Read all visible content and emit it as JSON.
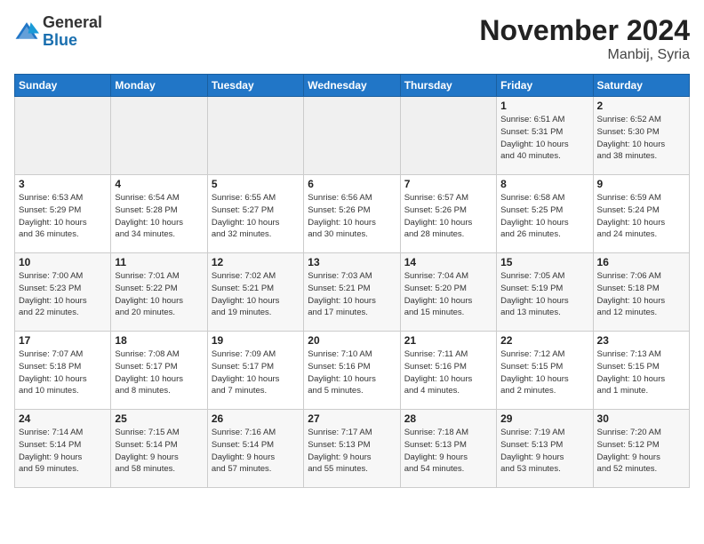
{
  "logo": {
    "line1": "General",
    "line2": "Blue"
  },
  "header": {
    "month": "November 2024",
    "location": "Manbij, Syria"
  },
  "weekdays": [
    "Sunday",
    "Monday",
    "Tuesday",
    "Wednesday",
    "Thursday",
    "Friday",
    "Saturday"
  ],
  "weeks": [
    [
      {
        "day": "",
        "info": ""
      },
      {
        "day": "",
        "info": ""
      },
      {
        "day": "",
        "info": ""
      },
      {
        "day": "",
        "info": ""
      },
      {
        "day": "",
        "info": ""
      },
      {
        "day": "1",
        "info": "Sunrise: 6:51 AM\nSunset: 5:31 PM\nDaylight: 10 hours\nand 40 minutes."
      },
      {
        "day": "2",
        "info": "Sunrise: 6:52 AM\nSunset: 5:30 PM\nDaylight: 10 hours\nand 38 minutes."
      }
    ],
    [
      {
        "day": "3",
        "info": "Sunrise: 6:53 AM\nSunset: 5:29 PM\nDaylight: 10 hours\nand 36 minutes."
      },
      {
        "day": "4",
        "info": "Sunrise: 6:54 AM\nSunset: 5:28 PM\nDaylight: 10 hours\nand 34 minutes."
      },
      {
        "day": "5",
        "info": "Sunrise: 6:55 AM\nSunset: 5:27 PM\nDaylight: 10 hours\nand 32 minutes."
      },
      {
        "day": "6",
        "info": "Sunrise: 6:56 AM\nSunset: 5:26 PM\nDaylight: 10 hours\nand 30 minutes."
      },
      {
        "day": "7",
        "info": "Sunrise: 6:57 AM\nSunset: 5:26 PM\nDaylight: 10 hours\nand 28 minutes."
      },
      {
        "day": "8",
        "info": "Sunrise: 6:58 AM\nSunset: 5:25 PM\nDaylight: 10 hours\nand 26 minutes."
      },
      {
        "day": "9",
        "info": "Sunrise: 6:59 AM\nSunset: 5:24 PM\nDaylight: 10 hours\nand 24 minutes."
      }
    ],
    [
      {
        "day": "10",
        "info": "Sunrise: 7:00 AM\nSunset: 5:23 PM\nDaylight: 10 hours\nand 22 minutes."
      },
      {
        "day": "11",
        "info": "Sunrise: 7:01 AM\nSunset: 5:22 PM\nDaylight: 10 hours\nand 20 minutes."
      },
      {
        "day": "12",
        "info": "Sunrise: 7:02 AM\nSunset: 5:21 PM\nDaylight: 10 hours\nand 19 minutes."
      },
      {
        "day": "13",
        "info": "Sunrise: 7:03 AM\nSunset: 5:21 PM\nDaylight: 10 hours\nand 17 minutes."
      },
      {
        "day": "14",
        "info": "Sunrise: 7:04 AM\nSunset: 5:20 PM\nDaylight: 10 hours\nand 15 minutes."
      },
      {
        "day": "15",
        "info": "Sunrise: 7:05 AM\nSunset: 5:19 PM\nDaylight: 10 hours\nand 13 minutes."
      },
      {
        "day": "16",
        "info": "Sunrise: 7:06 AM\nSunset: 5:18 PM\nDaylight: 10 hours\nand 12 minutes."
      }
    ],
    [
      {
        "day": "17",
        "info": "Sunrise: 7:07 AM\nSunset: 5:18 PM\nDaylight: 10 hours\nand 10 minutes."
      },
      {
        "day": "18",
        "info": "Sunrise: 7:08 AM\nSunset: 5:17 PM\nDaylight: 10 hours\nand 8 minutes."
      },
      {
        "day": "19",
        "info": "Sunrise: 7:09 AM\nSunset: 5:17 PM\nDaylight: 10 hours\nand 7 minutes."
      },
      {
        "day": "20",
        "info": "Sunrise: 7:10 AM\nSunset: 5:16 PM\nDaylight: 10 hours\nand 5 minutes."
      },
      {
        "day": "21",
        "info": "Sunrise: 7:11 AM\nSunset: 5:16 PM\nDaylight: 10 hours\nand 4 minutes."
      },
      {
        "day": "22",
        "info": "Sunrise: 7:12 AM\nSunset: 5:15 PM\nDaylight: 10 hours\nand 2 minutes."
      },
      {
        "day": "23",
        "info": "Sunrise: 7:13 AM\nSunset: 5:15 PM\nDaylight: 10 hours\nand 1 minute."
      }
    ],
    [
      {
        "day": "24",
        "info": "Sunrise: 7:14 AM\nSunset: 5:14 PM\nDaylight: 9 hours\nand 59 minutes."
      },
      {
        "day": "25",
        "info": "Sunrise: 7:15 AM\nSunset: 5:14 PM\nDaylight: 9 hours\nand 58 minutes."
      },
      {
        "day": "26",
        "info": "Sunrise: 7:16 AM\nSunset: 5:14 PM\nDaylight: 9 hours\nand 57 minutes."
      },
      {
        "day": "27",
        "info": "Sunrise: 7:17 AM\nSunset: 5:13 PM\nDaylight: 9 hours\nand 55 minutes."
      },
      {
        "day": "28",
        "info": "Sunrise: 7:18 AM\nSunset: 5:13 PM\nDaylight: 9 hours\nand 54 minutes."
      },
      {
        "day": "29",
        "info": "Sunrise: 7:19 AM\nSunset: 5:13 PM\nDaylight: 9 hours\nand 53 minutes."
      },
      {
        "day": "30",
        "info": "Sunrise: 7:20 AM\nSunset: 5:12 PM\nDaylight: 9 hours\nand 52 minutes."
      }
    ]
  ]
}
